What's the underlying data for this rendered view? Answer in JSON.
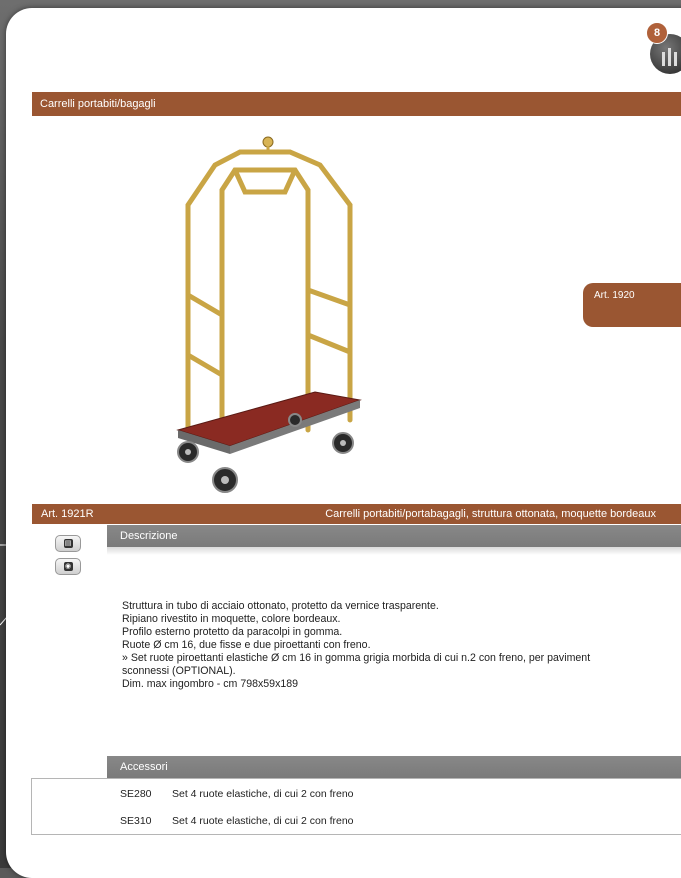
{
  "page": {
    "badge_number": "8",
    "section_title": "Carrelli portabiti/bagagli"
  },
  "product": {
    "image_tab_label": "Art. 1920",
    "article_code": "Art. 1921R",
    "article_description": "Carrelli portabiti/portabagagli, struttura ottonata, moquette bordeaux"
  },
  "description": {
    "heading": "Descrizione",
    "lines": [
      "Struttura in tubo di acciaio ottonato, protetto da vernice trasparente.",
      "Ripiano rivestito in moquette, colore bordeaux.",
      "Profilo esterno protetto da paracolpi in gomma.",
      "Ruote Ø cm 16, due fisse e due piroettanti con freno.",
      "» Set ruote piroettanti elastiche Ø cm 16 in gomma grigia morbida di cui n.2 con freno, per paviment",
      "sconnessi (OPTIONAL).",
      "Dim. max ingombro - cm 798x59x189"
    ]
  },
  "accessories": {
    "heading": "Accessori",
    "items": [
      {
        "code": "SE280",
        "text": "Set 4 ruote elastiche, di cui 2 con freno"
      },
      {
        "code": "SE310",
        "text": "Set 4 ruote elastiche, di cui 2 con freno"
      }
    ]
  },
  "icons": {
    "side_button_1": "document-icon",
    "side_button_2": "camera-icon",
    "corner": "hotel-trolley-logo-icon"
  },
  "colors": {
    "accent": "#9a5632",
    "section_grey": "#8a8a8a",
    "carpet": "#8a2a22",
    "brass": "#c9a545"
  }
}
